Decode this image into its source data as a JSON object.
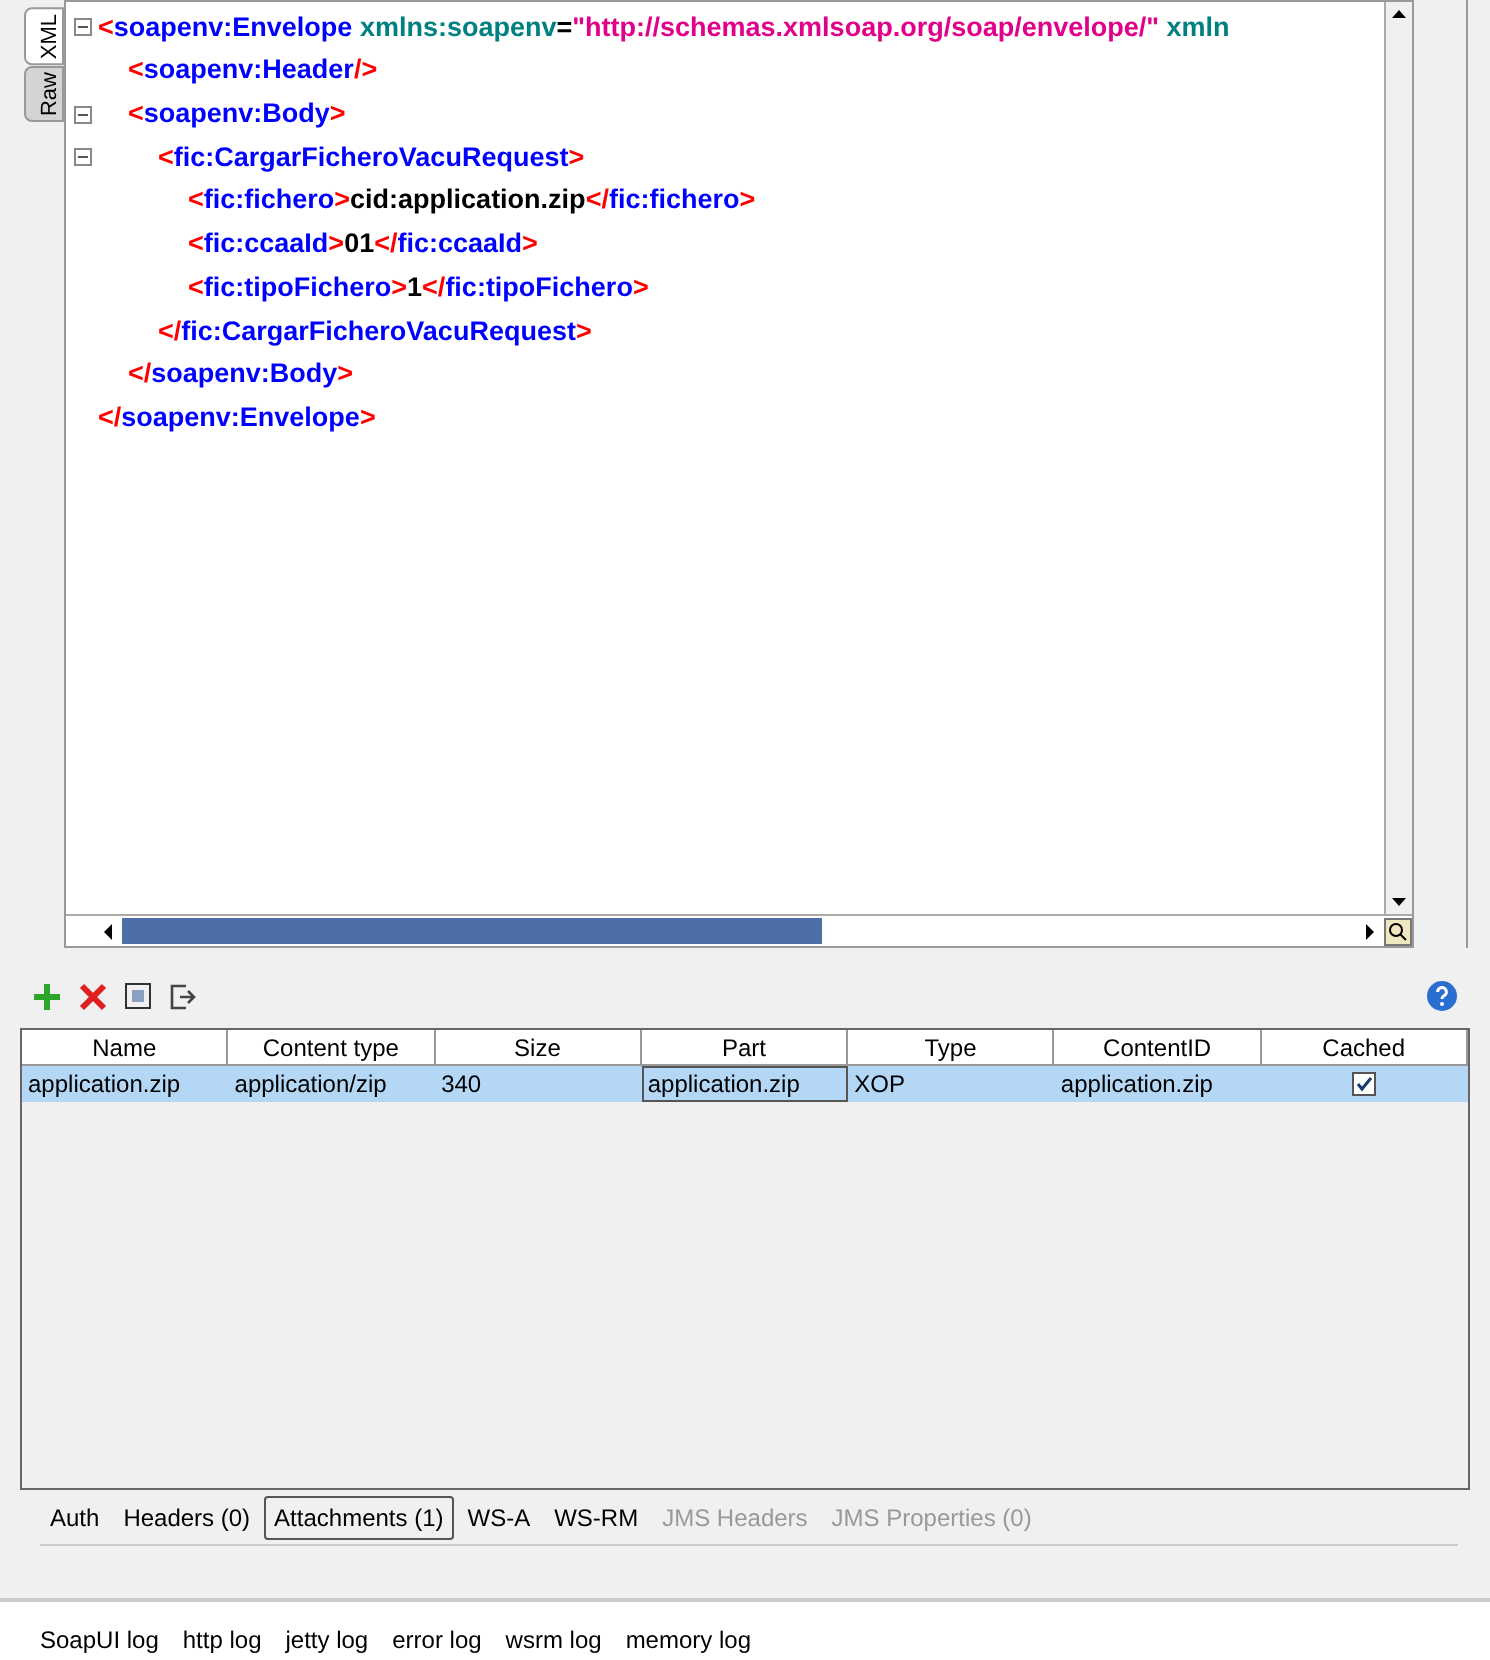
{
  "editor_tabs": [
    {
      "label": "XML",
      "selected": true
    },
    {
      "label": "Raw",
      "selected": false
    }
  ],
  "xml": [
    {
      "expanded": true,
      "open": [
        {
          "kind": "bracket",
          "text": "<"
        },
        {
          "kind": "tag",
          "text": "soapenv:Envelope"
        },
        {
          "kind": "attr",
          "text": " xmlns:soapenv"
        },
        {
          "kind": "text",
          "text": "="
        },
        {
          "kind": "value",
          "text": "\"http://schemas.xmlsoap.org/soap/envelope/\""
        },
        {
          "kind": "attr",
          "text": " xmln"
        }
      ],
      "children": [
        {
          "open": [
            {
              "kind": "bracket",
              "text": "<"
            },
            {
              "kind": "tag",
              "text": "soapenv:Header"
            },
            {
              "kind": "bracket",
              "text": "/>"
            }
          ]
        },
        {
          "expanded": true,
          "open": [
            {
              "kind": "bracket",
              "text": "<"
            },
            {
              "kind": "tag",
              "text": "soapenv:Body"
            },
            {
              "kind": "bracket",
              "text": ">"
            }
          ],
          "children": [
            {
              "expanded": true,
              "open": [
                {
                  "kind": "bracket",
                  "text": "<"
                },
                {
                  "kind": "tag",
                  "text": "fic:CargarFicheroVacuRequest"
                },
                {
                  "kind": "bracket",
                  "text": ">"
                }
              ],
              "children": [
                {
                  "open": [
                    {
                      "kind": "bracket",
                      "text": "<"
                    },
                    {
                      "kind": "tag",
                      "text": "fic:fichero"
                    },
                    {
                      "kind": "bracket",
                      "text": ">"
                    },
                    {
                      "kind": "text",
                      "text": "cid:application.zip"
                    },
                    {
                      "kind": "bracket",
                      "text": "</"
                    },
                    {
                      "kind": "tag",
                      "text": "fic:fichero"
                    },
                    {
                      "kind": "bracket",
                      "text": ">"
                    }
                  ]
                },
                {
                  "open": [
                    {
                      "kind": "bracket",
                      "text": "<"
                    },
                    {
                      "kind": "tag",
                      "text": "fic:ccaaId"
                    },
                    {
                      "kind": "bracket",
                      "text": ">"
                    },
                    {
                      "kind": "text",
                      "text": "01"
                    },
                    {
                      "kind": "bracket",
                      "text": "</"
                    },
                    {
                      "kind": "tag",
                      "text": "fic:ccaaId"
                    },
                    {
                      "kind": "bracket",
                      "text": ">"
                    }
                  ]
                },
                {
                  "open": [
                    {
                      "kind": "bracket",
                      "text": "<"
                    },
                    {
                      "kind": "tag",
                      "text": "fic:tipoFichero"
                    },
                    {
                      "kind": "bracket",
                      "text": ">"
                    },
                    {
                      "kind": "text",
                      "text": "1"
                    },
                    {
                      "kind": "bracket",
                      "text": "</"
                    },
                    {
                      "kind": "tag",
                      "text": "fic:tipoFichero"
                    },
                    {
                      "kind": "bracket",
                      "text": ">"
                    }
                  ]
                }
              ],
              "close": [
                {
                  "kind": "bracket",
                  "text": "</"
                },
                {
                  "kind": "tag",
                  "text": "fic:CargarFicheroVacuRequest"
                },
                {
                  "kind": "bracket",
                  "text": ">"
                }
              ]
            }
          ],
          "close": [
            {
              "kind": "bracket",
              "text": "</"
            },
            {
              "kind": "tag",
              "text": "soapenv:Body"
            },
            {
              "kind": "bracket",
              "text": ">"
            }
          ]
        }
      ],
      "close": [
        {
          "kind": "bracket",
          "text": "</"
        },
        {
          "kind": "tag",
          "text": "soapenv:Envelope"
        },
        {
          "kind": "bracket",
          "text": ">"
        }
      ]
    }
  ],
  "table": {
    "columns": [
      "Name",
      "Content type",
      "Size",
      "Part",
      "Type",
      "ContentID",
      "Cached"
    ],
    "rows": [
      {
        "selected": true,
        "cells": [
          "application.zip",
          "application/zip",
          "340",
          "application.zip",
          "XOP",
          "application.zip"
        ],
        "cached": true
      }
    ]
  },
  "request_tabs": [
    {
      "label": "Auth",
      "selected": false,
      "disabled": false
    },
    {
      "label": "Headers (0)",
      "selected": false,
      "disabled": false
    },
    {
      "label": "Attachments (1)",
      "selected": true,
      "disabled": false
    },
    {
      "label": "WS-A",
      "selected": false,
      "disabled": false
    },
    {
      "label": "WS-RM",
      "selected": false,
      "disabled": false
    },
    {
      "label": "JMS Headers",
      "selected": false,
      "disabled": true
    },
    {
      "label": "JMS Properties (0)",
      "selected": false,
      "disabled": true
    }
  ],
  "log_tabs": [
    "SoapUI log",
    "http log",
    "jetty log",
    "error log",
    "wsrm log",
    "memory log"
  ]
}
